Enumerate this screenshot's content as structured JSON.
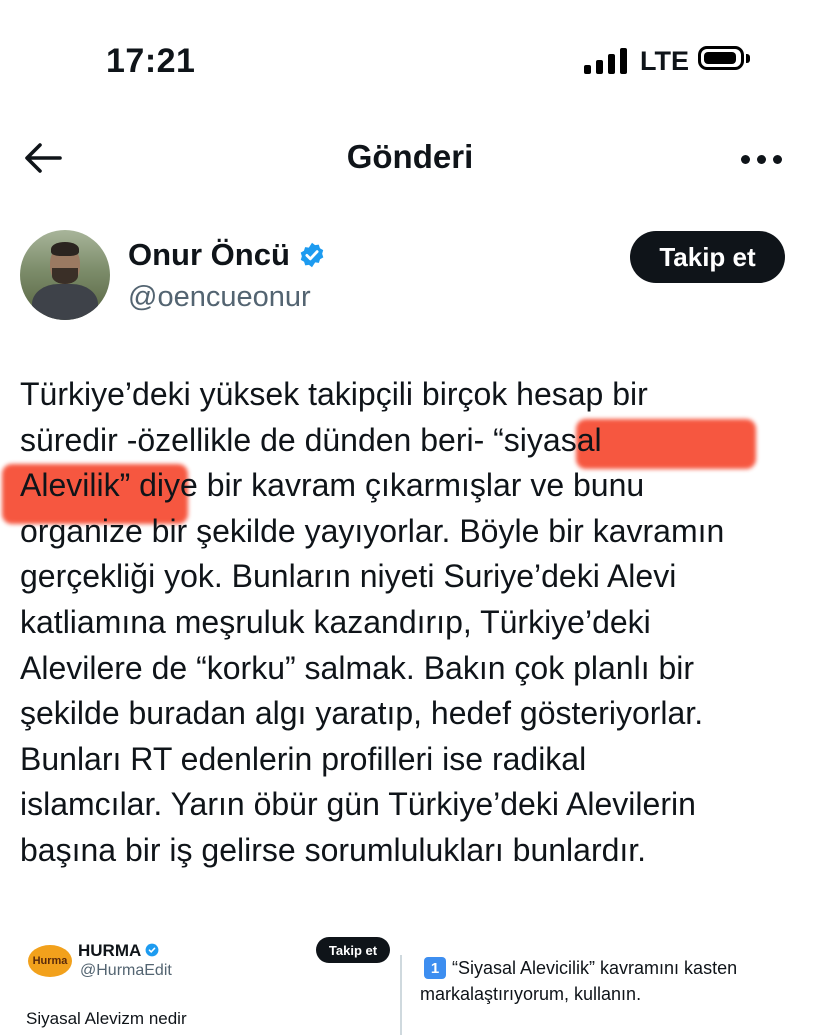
{
  "status_bar": {
    "time": "17:21",
    "network": "LTE"
  },
  "header": {
    "title": "Gönderi",
    "back_icon": "arrow-left-icon",
    "more_icon": "more-horizontal-icon"
  },
  "author": {
    "name": "Onur Öncü",
    "handle": "@oencueonur",
    "verified": true,
    "follow_label": "Takip et"
  },
  "tweet": {
    "lines": [
      "Türkiye’deki yüksek takipçili birçok hesap bir",
      "süredir -özellikle de dünden beri- “siyasal",
      "Alevilik” diye bir kavram çıkarmışlar ve bunu",
      "organize bir şekilde yayıyorlar. Böyle bir kavramın",
      "gerçekliği yok. Bunların niyeti Suriye’deki Alevi",
      "katliamına meşruluk kazandırıp, Türkiye’deki",
      "Alevilere de “korku” salmak. Bakın çok planlı bir",
      "şekilde buradan algı yaratıp, hedef gösteriyorlar.",
      "Bunları RT edenlerin profilleri ise radikal",
      "islamcılar. Yarın öbür gün Türkiye’deki Alevilerin",
      "başına bir iş gelirse sorumlulukları bunlardır."
    ],
    "highlight_color": "#f53a1f"
  },
  "quoted": {
    "left": {
      "logo_text": "Hurma",
      "name": "HURMA",
      "handle": "@HurmaEdit",
      "follow_label": "Takip et",
      "text": "Siyasal Alevizm nedir"
    },
    "right": {
      "number": "1",
      "line1": "“Siyasal Alevicilik” kavramını kasten",
      "line2": "markalaştırıyorum, kullanın."
    }
  },
  "colors": {
    "text": "#0f1419",
    "secondary": "#536471",
    "verified": "#1d9bf0"
  }
}
